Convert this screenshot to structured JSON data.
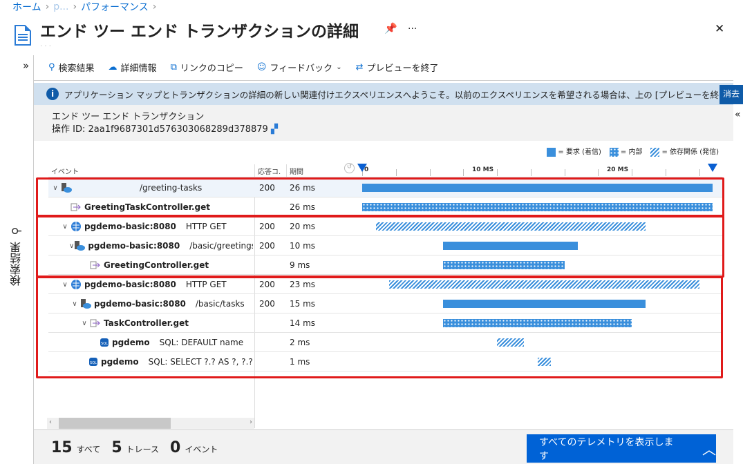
{
  "breadcrumb": {
    "items": [
      "ホーム",
      "p...",
      "パフォーマンス"
    ]
  },
  "header": {
    "title": "エンド ツー エンド トランザクションの詳細",
    "more": "···",
    "close": "✕"
  },
  "toolbar": {
    "search": "検索結果",
    "details": "詳細情報",
    "copy_link": "リンクのコピー",
    "feedback": "フィードバック",
    "end_preview": "プレビューを終了"
  },
  "sidebar": {
    "expand": "»",
    "label": "検索結果",
    "collapse_right": "«"
  },
  "banner": {
    "text": "アプリケーション マップとトランザクションの詳細の新しい関連付けエクスペリエンスへようこそ。以前のエクスペリエンスを希望される場合は、上の [プレビューを終...",
    "dismiss": "消去"
  },
  "transaction": {
    "heading": "エンド ツー エンド トランザクション",
    "operation_id": "操作 ID: 2aa1f9687301d576303068289d378879"
  },
  "legend": {
    "request": "= 要求 (着信)",
    "internal": "= 内部",
    "dependency": "= 依存関係 (発信)"
  },
  "columns": {
    "event": "イベント",
    "code": "応答コ.",
    "duration": "期間"
  },
  "timeline": {
    "max_ms": 26,
    "ticks": [
      {
        "ms": 0,
        "label": "0"
      },
      {
        "ms": 10,
        "label": "10 MS"
      },
      {
        "ms": 20,
        "label": "20 MS"
      }
    ],
    "minor_step_ms": 2.5
  },
  "rows": [
    {
      "level": 0,
      "chevron": true,
      "icon": "server-icon",
      "name": "",
      "detail": "/greeting-tasks",
      "code": "200",
      "duration": "26 ms",
      "start": 0,
      "ms": 26,
      "bar": "solid",
      "selected": true
    },
    {
      "level": 1,
      "chevron": false,
      "icon": "function-icon",
      "name": "GreetingTaskController.get",
      "detail": "",
      "code": "",
      "duration": "26 ms",
      "start": 0,
      "ms": 26,
      "bar": "dots"
    },
    {
      "level": 1,
      "chevron": true,
      "icon": "http-globe-icon",
      "name": "pgdemo-basic:8080",
      "detail": "HTTP GET",
      "code": "200",
      "duration": "20 ms",
      "start": 1,
      "ms": 20,
      "bar": "hatch"
    },
    {
      "level": 2,
      "chevron": true,
      "icon": "server-icon",
      "name": "pgdemo-basic:8080",
      "detail": "/basic/greetings",
      "code": "200",
      "duration": "10 ms",
      "start": 6,
      "ms": 10,
      "bar": "solid"
    },
    {
      "level": 3,
      "chevron": false,
      "icon": "function-icon",
      "name": "GreetingController.get",
      "detail": "",
      "code": "",
      "duration": "9 ms",
      "start": 6,
      "ms": 9,
      "bar": "dots"
    },
    {
      "level": 1,
      "chevron": true,
      "icon": "http-globe-icon",
      "name": "pgdemo-basic:8080",
      "detail": "HTTP GET",
      "code": "200",
      "duration": "23 ms",
      "start": 2,
      "ms": 23,
      "bar": "hatch"
    },
    {
      "level": 2,
      "chevron": true,
      "icon": "server-icon",
      "name": "pgdemo-basic:8080",
      "detail": "/basic/tasks",
      "code": "200",
      "duration": "15 ms",
      "start": 6,
      "ms": 15,
      "bar": "solid"
    },
    {
      "level": 3,
      "chevron": true,
      "icon": "function-icon",
      "name": "TaskController.get",
      "detail": "",
      "code": "",
      "duration": "14 ms",
      "start": 6,
      "ms": 14,
      "bar": "dots"
    },
    {
      "level": 4,
      "chevron": false,
      "icon": "sql-icon",
      "name": "pgdemo",
      "detail": "SQL: DEFAULT name",
      "code": "",
      "duration": "2 ms",
      "start": 10,
      "ms": 2,
      "bar": "hatch"
    },
    {
      "level": 4,
      "chevron": false,
      "icon": "sql-icon",
      "name": "pgdemo",
      "detail": "SQL: SELECT ?.? AS ?, ?.? A",
      "code": "",
      "duration": "1 ms",
      "start": 13,
      "ms": 1,
      "bar": "hatch"
    }
  ],
  "footer": {
    "all_count": "15",
    "all_label": "すべて",
    "trace_count": "5",
    "trace_label": "トレース",
    "event_count": "0",
    "event_label": "イベント",
    "show_all": "すべてのテレメトリを表示します"
  }
}
